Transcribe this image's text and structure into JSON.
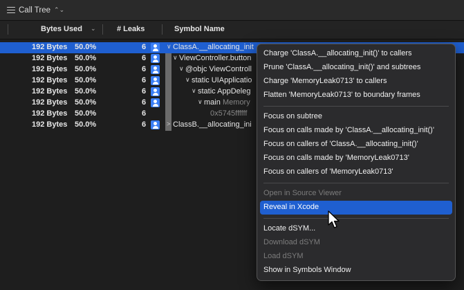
{
  "toolbar": {
    "call_tree_label": "Call Tree"
  },
  "columns": {
    "bytes_used": "Bytes Used",
    "leaks": "# Leaks",
    "symbol_name": "Symbol Name"
  },
  "rows": [
    {
      "bytes": "192 Bytes",
      "pct": "50.0%",
      "leaks": "6",
      "symbol": "ClassA.__allocating_init",
      "twist": "∨",
      "has_icon": true
    },
    {
      "bytes": "192 Bytes",
      "pct": "50.0%",
      "leaks": "6",
      "symbol": "ViewController.button",
      "twist": "∨",
      "has_icon": true
    },
    {
      "bytes": "192 Bytes",
      "pct": "50.0%",
      "leaks": "6",
      "symbol": "@objc ViewControll",
      "twist": "∨",
      "has_icon": true
    },
    {
      "bytes": "192 Bytes",
      "pct": "50.0%",
      "leaks": "6",
      "symbol": "static UIApplicatio",
      "twist": "∨",
      "has_icon": true
    },
    {
      "bytes": "192 Bytes",
      "pct": "50.0%",
      "leaks": "6",
      "symbol": "static AppDeleg",
      "twist": "∨",
      "has_icon": true
    },
    {
      "bytes": "192 Bytes",
      "pct": "50.0%",
      "leaks": "6",
      "symbol": "main",
      "symbol_extra": "Memory",
      "twist": "∨",
      "has_icon": true
    },
    {
      "bytes": "192 Bytes",
      "pct": "50.0%",
      "leaks": "6",
      "symbol": "0x5745ffffff",
      "twist": "",
      "has_icon": false
    },
    {
      "bytes": "192 Bytes",
      "pct": "50.0%",
      "leaks": "6",
      "symbol": "ClassB.__allocating_ini",
      "twist": ">",
      "has_icon": true
    }
  ],
  "context_menu": {
    "charge_caller": "Charge 'ClassA.__allocating_init()' to callers",
    "prune": "Prune 'ClassA.__allocating_init()' and subtrees",
    "charge_lib": "Charge 'MemoryLeak0713' to callers",
    "flatten": "Flatten 'MemoryLeak0713' to boundary frames",
    "focus_subtree": "Focus on subtree",
    "focus_calls_made_a": "Focus on calls made by 'ClassA.__allocating_init()'",
    "focus_callers_a": "Focus on callers of 'ClassA.__allocating_init()'",
    "focus_calls_made_lib": "Focus on calls made by 'MemoryLeak0713'",
    "focus_callers_lib": "Focus on callers of 'MemoryLeak0713'",
    "open_source": "Open in Source Viewer",
    "reveal_xcode": "Reveal in Xcode",
    "locate_dsym": "Locate dSYM...",
    "download_dsym": "Download dSYM",
    "load_dsym": "Load dSYM",
    "show_symbols": "Show in Symbols Window"
  },
  "colors": {
    "selection": "#1f5fd0",
    "background": "#1e1e1e",
    "menu_bg": "#2b2b2d"
  }
}
